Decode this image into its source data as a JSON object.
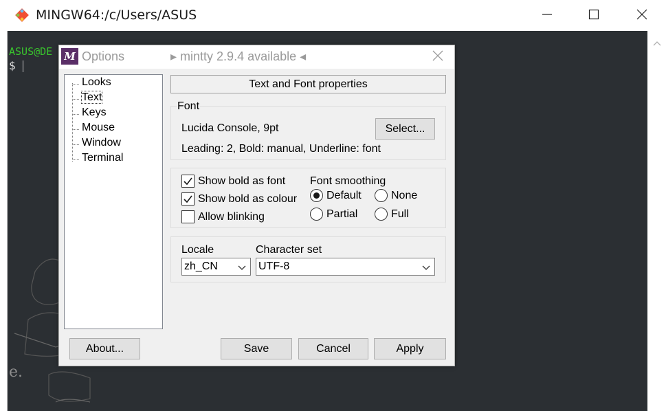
{
  "window": {
    "title": "MINGW64:/c/Users/ASUS",
    "icon": "git-diamond-icon"
  },
  "terminal": {
    "prompt_user": "ASUS@DE",
    "prompt_symbol": "$",
    "background_text": "e."
  },
  "dialog": {
    "title": "Options",
    "notice": "▸ mintty 2.9.4 available ◂",
    "icon_glyph": "M",
    "tree": [
      "Looks",
      "Text",
      "Keys",
      "Mouse",
      "Window",
      "Terminal"
    ],
    "selected_tree_item": "Text",
    "header": "Text and Font properties",
    "font": {
      "legend": "Font",
      "name": "Lucida Console, 9pt",
      "select_button": "Select...",
      "details": "Leading: 2, Bold: manual, Underline: font"
    },
    "options": {
      "checkboxes": [
        {
          "label": "Show bold as font",
          "checked": true
        },
        {
          "label": "Show bold as colour",
          "checked": true
        },
        {
          "label": "Allow blinking",
          "checked": false
        }
      ],
      "smoothing": {
        "label": "Font smoothing",
        "choices": [
          {
            "label": "Default",
            "selected": true
          },
          {
            "label": "None",
            "selected": false
          },
          {
            "label": "Partial",
            "selected": false
          },
          {
            "label": "Full",
            "selected": false
          }
        ]
      }
    },
    "locale": {
      "label": "Locale",
      "value": "zh_CN",
      "charset_label": "Character set",
      "charset_value": "UTF-8"
    },
    "buttons": {
      "about": "About...",
      "save": "Save",
      "cancel": "Cancel",
      "apply": "Apply"
    }
  },
  "colors": {
    "terminal_bg": "#2b2f33",
    "prompt_green": "#39c42d",
    "dialog_bg": "#f0f0f0",
    "dialog_icon_bg": "#5a2e67"
  }
}
